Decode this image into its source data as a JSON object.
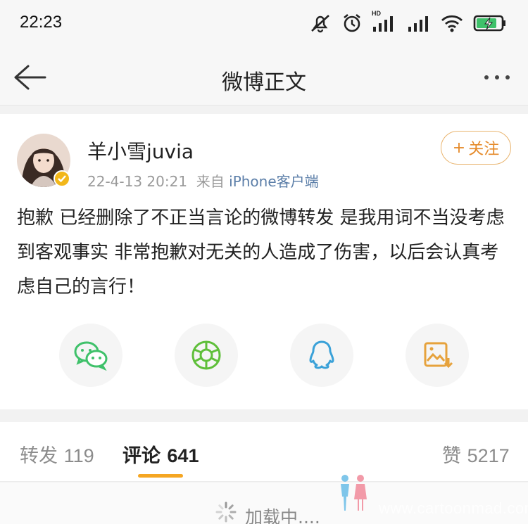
{
  "status_bar": {
    "time": "22:23",
    "icons": [
      "mute-icon",
      "alarm-icon",
      "signal-hd-icon",
      "signal-icon",
      "wifi-icon",
      "battery-charging-icon"
    ],
    "hd_label": "HD"
  },
  "nav": {
    "title": "微博正文",
    "back_icon": "back-arrow-icon",
    "more_icon": "more-dots-icon"
  },
  "post": {
    "username": "羊小雪juvia",
    "date": "22-4-13 20:21",
    "source_prefix": "来自",
    "source": "iPhone客户端",
    "follow_label": "关注",
    "follow_plus": "+",
    "text": "抱歉 已经删除了不正当言论的微博转发 是我用词不当没考虑到客观事实 非常抱歉对无关的人造成了伤害，以后会认真考虑自己的言行！",
    "share_targets": [
      "wechat-icon",
      "moments-icon",
      "qq-icon",
      "save-image-icon"
    ]
  },
  "tabs": {
    "repost_label": "转发",
    "repost_count": "119",
    "comment_label": "评论",
    "comment_count": "641",
    "like_label": "赞",
    "like_count": "5217"
  },
  "loading": {
    "text": "加载中...."
  },
  "watermark": {
    "text": "www.cartoonmad.com"
  },
  "colors": {
    "accent": "#f5a623",
    "follow_text": "#e58a2a",
    "source_link": "#5b7ea8",
    "wechat_green": "#3fc16a",
    "qq_blue": "#3aa1d8"
  }
}
